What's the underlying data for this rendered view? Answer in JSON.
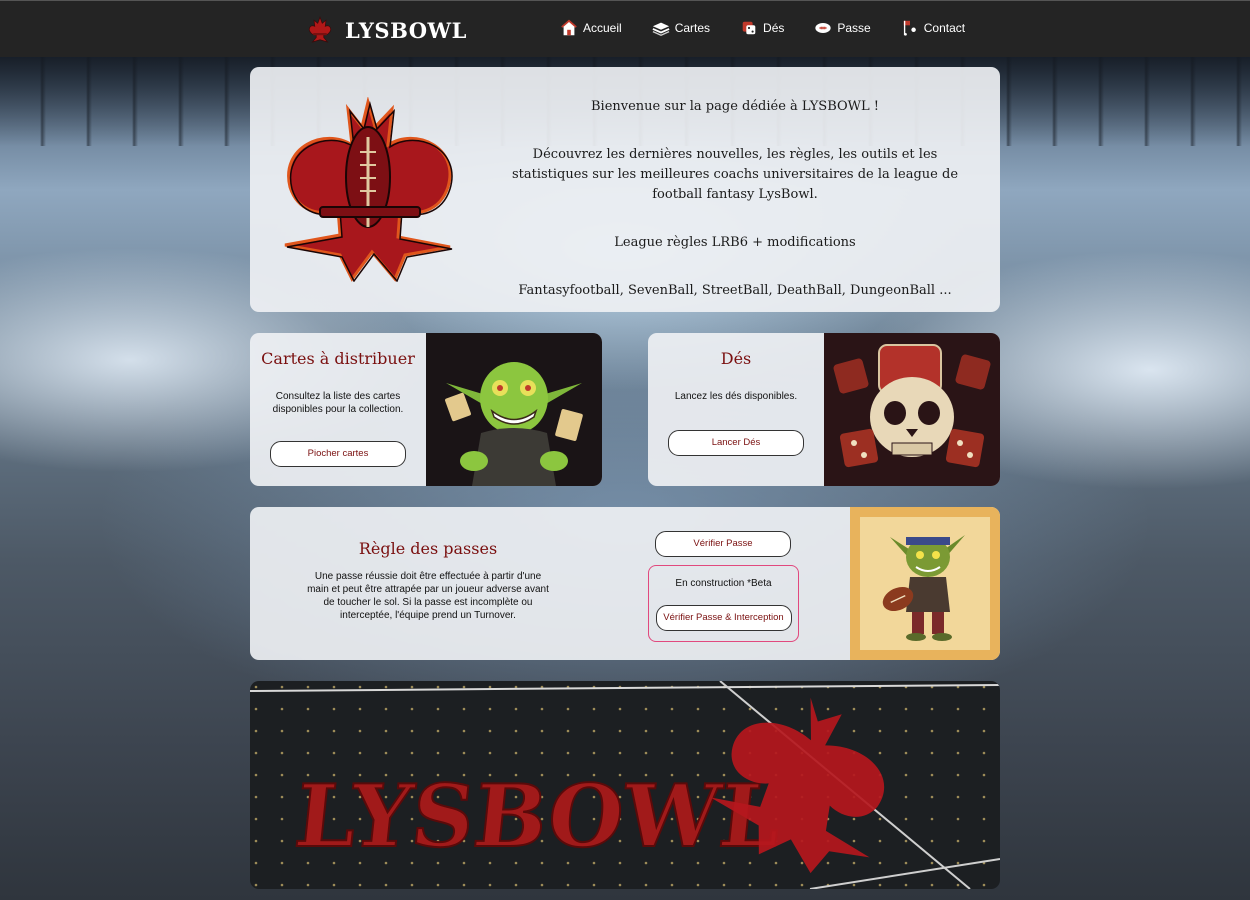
{
  "brand": {
    "name": "LYSBOWL",
    "accent": "#7a1010"
  },
  "nav": {
    "items": [
      {
        "label": "Accueil",
        "icon": "house-icon"
      },
      {
        "label": "Cartes",
        "icon": "cards-stack-icon"
      },
      {
        "label": "Dés",
        "icon": "dice-icon"
      },
      {
        "label": "Passe",
        "icon": "football-icon"
      },
      {
        "label": "Contact",
        "icon": "contact-icon"
      }
    ]
  },
  "hero": {
    "welcome": "Bienvenue sur la page dédiée à LYSBOWL !",
    "intro": "Découvrez les dernières nouvelles, les règles, les outils et les statistiques sur les meilleures coachs universitaires de la league de football fantasy LysBowl.",
    "rules": "League règles LRB6 + modifications",
    "variants": "Fantasyfootball, SevenBall, StreetBall, DeathBall, DungeonBall ..."
  },
  "cartes": {
    "title": "Cartes à distribuer",
    "description": "Consultez la liste des cartes disponibles pour la collection.",
    "button": "Piocher cartes"
  },
  "des": {
    "title": "Dés",
    "description": "Lancez les dés disponibles.",
    "button": "Lancer Dés"
  },
  "passes": {
    "title": "Règle des passes",
    "description": "Une passe réussie doit être effectuée à partir d'une main et peut être attrapée par un joueur adverse avant de toucher le sol. Si la passe est incomplète ou interceptée, l'équipe prend un Turnover.",
    "button_verify": "Vérifier Passe",
    "beta_label": "En construction *Beta",
    "button_interception": "Vérifier Passe & Interception"
  },
  "banner": {
    "text": "LYSBOWL"
  }
}
